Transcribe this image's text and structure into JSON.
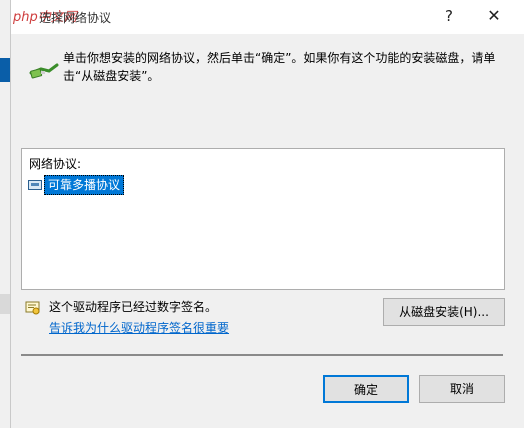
{
  "dialog": {
    "title": "选择网络协议",
    "help_glyph": "?",
    "close_glyph": "✕",
    "instructions": "单击你想安装的网络协议，然后单击“确定”。如果你有这个功能的安装磁盘，请单击“从磁盘安装”。"
  },
  "watermark": {
    "text": "php中文网"
  },
  "protocol_list": {
    "header": "网络协议:",
    "items": [
      {
        "label": "可靠多播协议",
        "selected": true,
        "icon": "network-protocol-icon"
      }
    ]
  },
  "signature": {
    "status_text": "这个驱动程序已经过数字签名。",
    "link_text": "告诉我为什么驱动程序签名很重要"
  },
  "buttons": {
    "have_disk": "从磁盘安装(H)...",
    "ok": "确定",
    "cancel": "取消"
  },
  "colors": {
    "accent": "#0078d7",
    "link": "#0066cc",
    "dialog_bg": "#f0f0f0"
  }
}
